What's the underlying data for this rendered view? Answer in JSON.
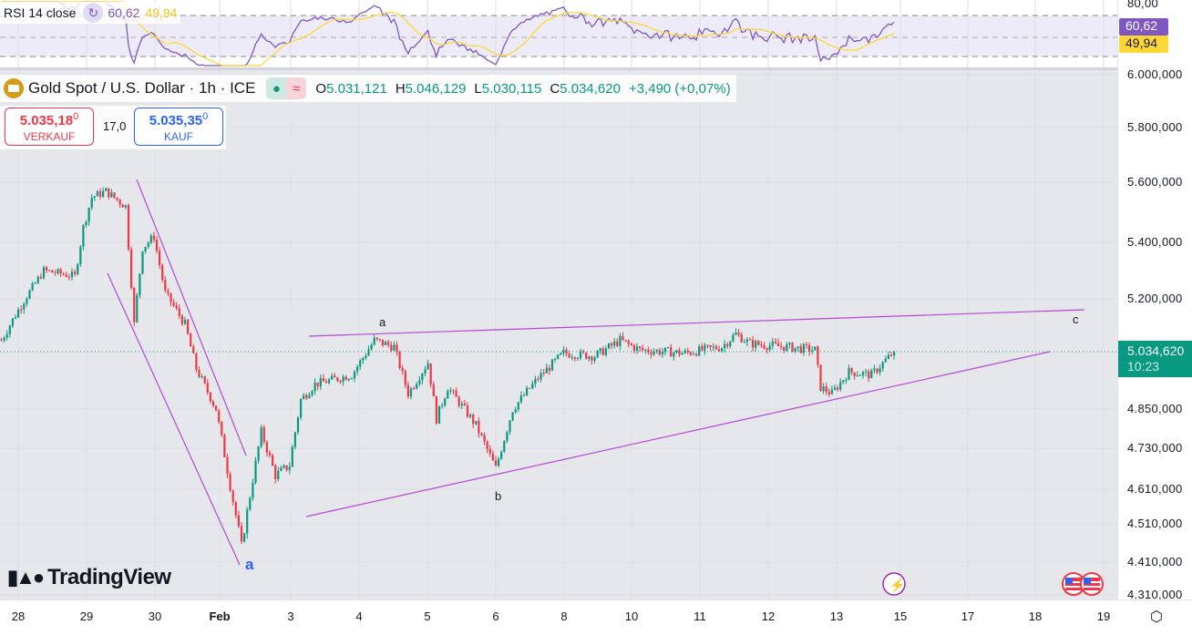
{
  "rsi": {
    "label": "RSI 14 close",
    "value": "60,62",
    "ma_value": "49,94",
    "axis_top": "80,00",
    "colors": {
      "rsi": "#7e57c2",
      "ma": "#fdd835"
    }
  },
  "legend": {
    "title": "Gold Spot / U.S. Dollar · 1h · ICE",
    "open_label": "O",
    "open": "5.031,121",
    "high_label": "H",
    "high": "5.046,129",
    "low_label": "L",
    "low": "5.030,115",
    "close_label": "C",
    "close": "5.034,620",
    "change": "+3,490 (+0,07%)",
    "status_icon": "●",
    "wave_icon": "≈"
  },
  "trade": {
    "sell_price": "5.035,18",
    "sell_sup": "0",
    "sell_label": "VERKAUF",
    "spread": "17,0",
    "buy_price": "5.035,35",
    "buy_sup": "0",
    "buy_label": "KAUF"
  },
  "price_axis": [
    "6.000,000",
    "5.800,000",
    "5.600,000",
    "5.400,000",
    "5.200,000",
    "4.850,000",
    "4.730,000",
    "4.610,000",
    "4.510,000",
    "4.410,000",
    "4.310,000"
  ],
  "last_price": {
    "value": "5.034,620",
    "countdown": "10:23"
  },
  "time_axis": [
    "28",
    "29",
    "30",
    "Feb",
    "3",
    "4",
    "5",
    "6",
    "8",
    "10",
    "11",
    "12",
    "13",
    "15",
    "17",
    "18",
    "19"
  ],
  "annotations": {
    "wave_a_top": "a",
    "wave_b": "b",
    "wave_c": "c",
    "wave_a_low": "a"
  },
  "brand": "TradingView",
  "chart_data": {
    "type": "candlestick",
    "symbol": "XAUUSD",
    "interval": "1h",
    "ylim": [
      4310,
      6000
    ],
    "waypoints_hour_price": [
      [
        0,
        5070
      ],
      [
        5,
        5150
      ],
      [
        15,
        5300
      ],
      [
        26,
        5280
      ],
      [
        29,
        5450
      ],
      [
        32,
        5550
      ],
      [
        37,
        5570
      ],
      [
        44,
        5520
      ],
      [
        47,
        5120
      ],
      [
        50,
        5380
      ],
      [
        54,
        5420
      ],
      [
        58,
        5220
      ],
      [
        65,
        5120
      ],
      [
        69,
        4980
      ],
      [
        76,
        4850
      ],
      [
        81,
        4620
      ],
      [
        85,
        4450
      ],
      [
        92,
        4780
      ],
      [
        97,
        4650
      ],
      [
        102,
        4680
      ],
      [
        106,
        4880
      ],
      [
        111,
        4930
      ],
      [
        124,
        4960
      ],
      [
        132,
        5070
      ],
      [
        139,
        5050
      ],
      [
        144,
        4900
      ],
      [
        151,
        5000
      ],
      [
        154,
        4820
      ],
      [
        158,
        4920
      ],
      [
        168,
        4800
      ],
      [
        175,
        4670
      ],
      [
        181,
        4850
      ],
      [
        190,
        4950
      ],
      [
        199,
        5030
      ],
      [
        210,
        5020
      ],
      [
        219,
        5070
      ],
      [
        226,
        5040
      ],
      [
        242,
        5030
      ],
      [
        255,
        5050
      ],
      [
        260,
        5090
      ],
      [
        265,
        5060
      ],
      [
        277,
        5050
      ],
      [
        288,
        5040
      ],
      [
        290,
        4920
      ],
      [
        294,
        4900
      ],
      [
        300,
        4970
      ],
      [
        308,
        4960
      ],
      [
        316,
        5034.62
      ]
    ],
    "colors": {
      "up": "#089981",
      "down": "#f23645",
      "lines": "#b548d6"
    }
  }
}
